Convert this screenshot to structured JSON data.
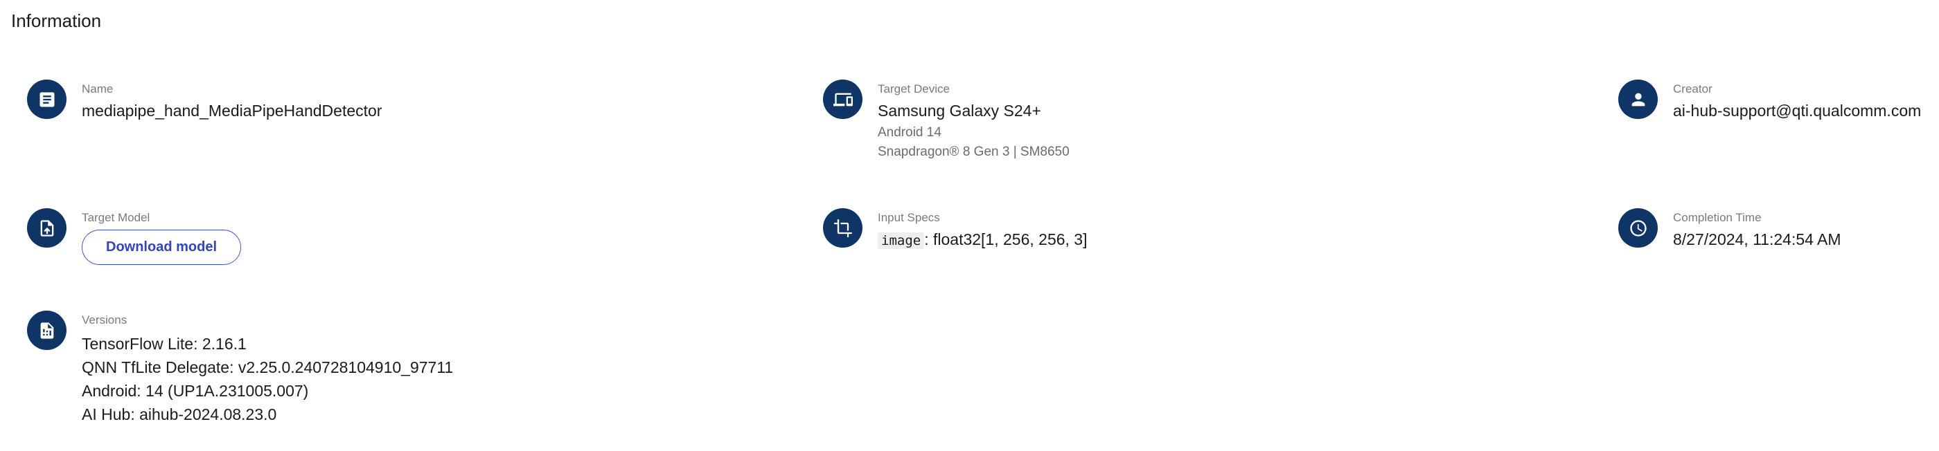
{
  "section": {
    "title": "Information"
  },
  "name": {
    "label": "Name",
    "value": "mediapipe_hand_MediaPipeHandDetector",
    "icon": "description-icon"
  },
  "target_device": {
    "label": "Target Device",
    "value": "Samsung Galaxy S24+",
    "os": "Android 14",
    "chipset": "Snapdragon® 8 Gen 3 | SM8650",
    "icon": "devices-icon"
  },
  "creator": {
    "label": "Creator",
    "value": "ai-hub-support@qti.qualcomm.com",
    "icon": "person-icon"
  },
  "target_model": {
    "label": "Target Model",
    "button_label": "Download model",
    "icon": "file-upload-icon"
  },
  "input_specs": {
    "label": "Input Specs",
    "input_name": "image",
    "input_shape": ": float32[1, 256, 256, 3]",
    "icon": "crop-icon"
  },
  "completion_time": {
    "label": "Completion Time",
    "value": "8/27/2024, 11:24:54 AM",
    "icon": "clock-icon"
  },
  "versions": {
    "label": "Versions",
    "lines": [
      "TensorFlow Lite: 2.16.1",
      "QNN TfLite Delegate: v2.25.0.240728104910_97711",
      "Android: 14 (UP1A.231005.007)",
      "AI Hub: aihub-2024.08.23.0"
    ],
    "icon": "file-info-icon"
  },
  "colors": {
    "icon_background": "#0f3566",
    "button_accent": "#3345b8",
    "label_text": "#7a7a80"
  }
}
